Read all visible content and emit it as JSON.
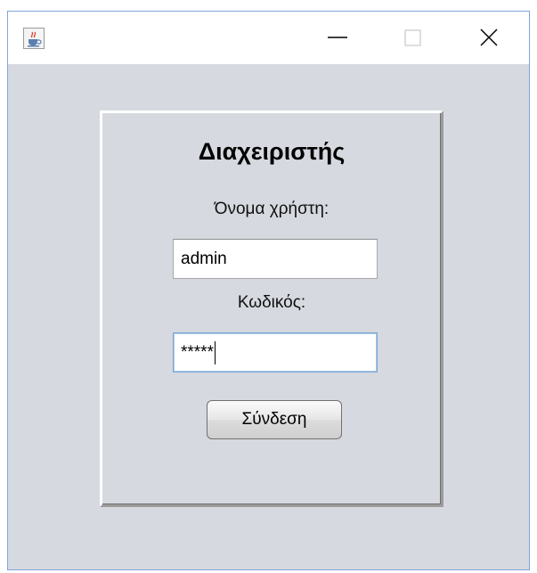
{
  "window": {
    "title_icon": "java-cup-icon",
    "controls": [
      "minimize-icon",
      "maximize-icon",
      "close-icon"
    ]
  },
  "panel": {
    "title": "Διαχειριστής",
    "username_label": "Όνομα χρήστη:",
    "username_value": "admin",
    "password_label": "Κωδικός:",
    "password_value": "*****",
    "login_label": "Σύνδεση"
  },
  "colors": {
    "window_bg": "#d6d9df",
    "titlebar_bg": "#ffffff",
    "window_border": "#7ea6dc",
    "focus_border": "#7ba6d6"
  }
}
